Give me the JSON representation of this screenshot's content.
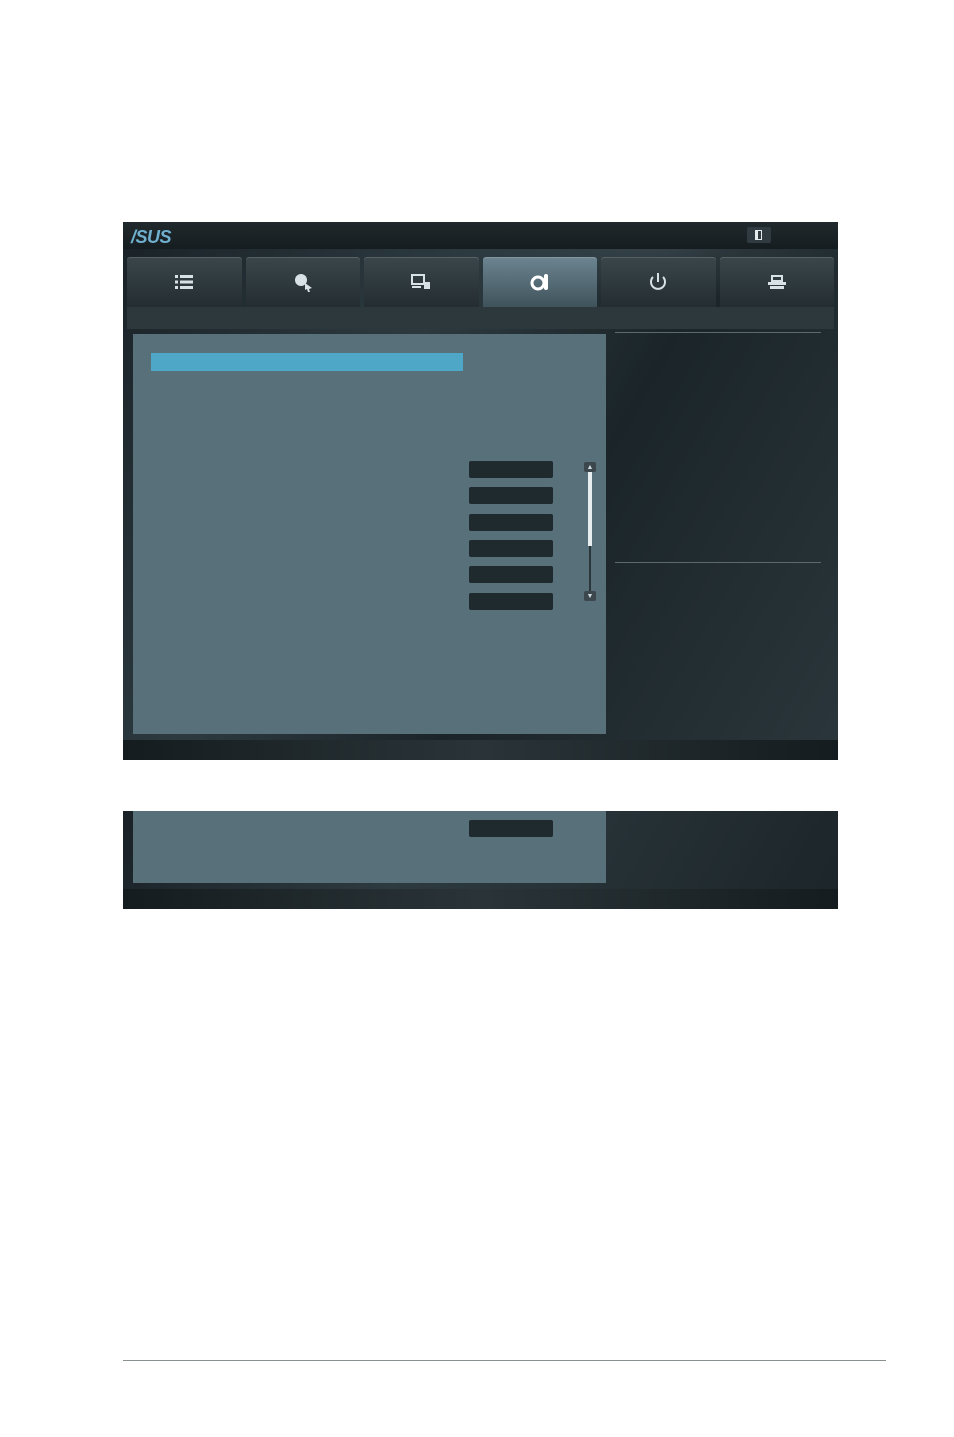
{
  "app": {
    "brand_logo": "/SUS",
    "accent_color": "#4ea7c6",
    "panel_color": "#587079"
  },
  "tabs": [
    {
      "icon": "list-icon",
      "active": false
    },
    {
      "icon": "gear-pointer-icon",
      "active": false
    },
    {
      "icon": "device-lock-icon",
      "active": false
    },
    {
      "icon": "monitor-gear-icon",
      "active": true
    },
    {
      "icon": "power-icon",
      "active": false
    },
    {
      "icon": "tool-icon",
      "active": false
    }
  ],
  "header": {
    "exit_icon": "exit-door-icon"
  },
  "settings": {
    "value_rows": [
      "",
      "",
      "",
      "",
      "",
      ""
    ],
    "scrollbar": {
      "position_fraction": 0.05
    }
  },
  "continuation": {
    "value_rows": [
      ""
    ]
  }
}
